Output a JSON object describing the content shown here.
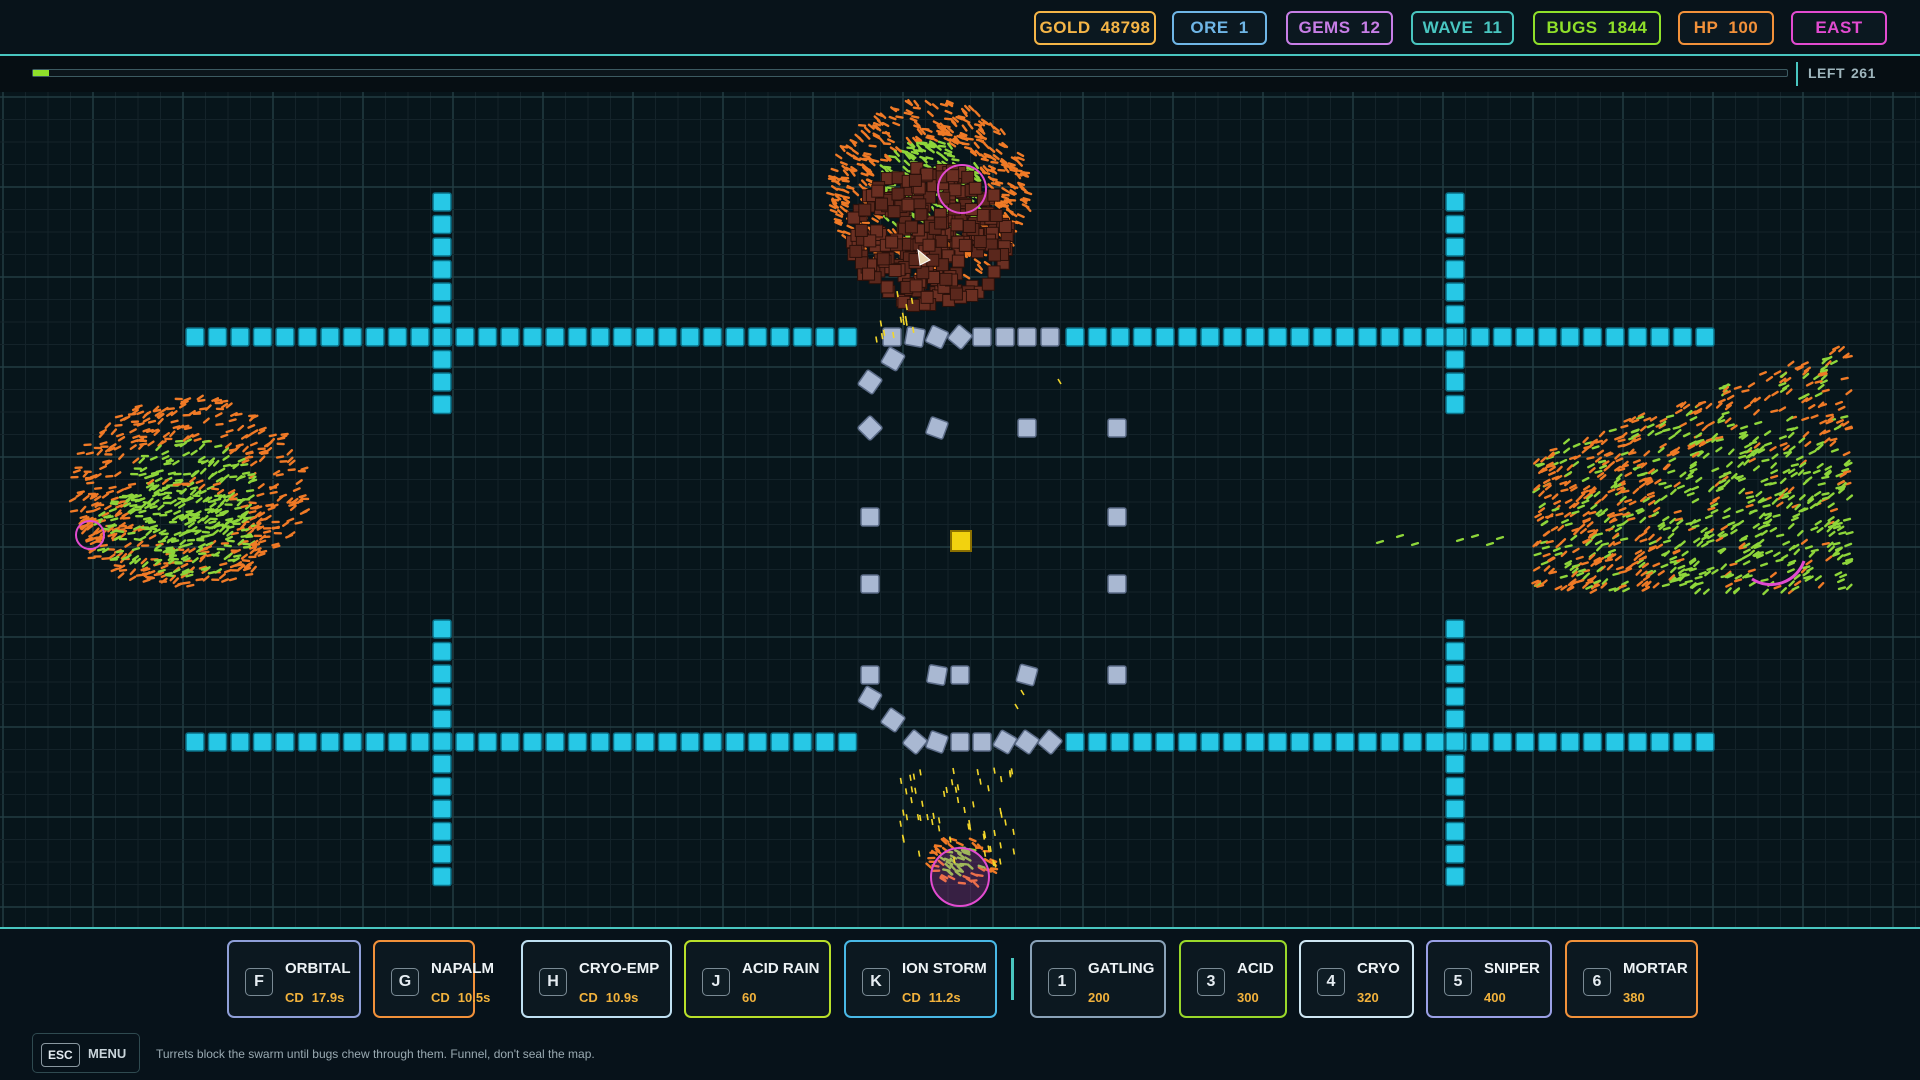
{
  "hud": {
    "stats": [
      {
        "label": "GOLD",
        "value": "48798",
        "color": "#f5b547"
      },
      {
        "label": "ORE",
        "value": "1",
        "color": "#6fb6e6"
      },
      {
        "label": "GEMS",
        "value": "12",
        "color": "#c77ee6"
      },
      {
        "label": "WAVE",
        "value": "11",
        "color": "#49c6c0"
      },
      {
        "label": "BUGS",
        "value": "1844",
        "color": "#8fe02a"
      },
      {
        "label": "HP",
        "value": "100",
        "color": "#f2913a"
      },
      {
        "label": "EAST",
        "value": "",
        "color": "#e24bd0"
      }
    ],
    "wave_progress": 0.009,
    "left_label": "LEFT",
    "left_value": "261"
  },
  "abilities": [
    {
      "key": "F",
      "name": "ORBITAL",
      "cd_label": "CD",
      "cd": "17.9s",
      "color": "#8f9fd8"
    },
    {
      "key": "G",
      "name": "NAPALM",
      "cd_label": "CD",
      "cd": "10.5s",
      "color": "#f2913a"
    },
    {
      "key": "H",
      "name": "CRYO-EMP",
      "cd_label": "CD",
      "cd": "10.9s",
      "color": "#bfe0f2"
    },
    {
      "key": "J",
      "name": "ACID RAIN",
      "cd_label": "",
      "cd": "60",
      "color": "#b9e02a"
    },
    {
      "key": "K",
      "name": "ION STORM",
      "cd_label": "CD",
      "cd": "11.2s",
      "color": "#49b8e6"
    }
  ],
  "turrets": [
    {
      "key": "1",
      "name": "GATLING",
      "cost": "200",
      "color": "#8aa2b8"
    },
    {
      "key": "3",
      "name": "ACID",
      "cost": "300",
      "color": "#9ad82a"
    },
    {
      "key": "4",
      "name": "CRYO",
      "cost": "320",
      "color": "#cfe6f2"
    },
    {
      "key": "5",
      "name": "SNIPER",
      "cost": "400",
      "color": "#9aa0e6"
    },
    {
      "key": "6",
      "name": "MORTAR",
      "cost": "380",
      "color": "#f2913a"
    }
  ],
  "menu": {
    "key": "ESC",
    "label": "MENU"
  },
  "hint": "Turrets block the swarm until bugs chew through them. Funnel, don't seal the map.",
  "colors": {
    "grid_minor": "#14232a",
    "grid_major": "#223d42",
    "wall": "#27c8e6",
    "turret": "#a9b8d2",
    "core": "#f2d20f",
    "bug_orange": "#f07a26",
    "bug_green": "#8ed63a",
    "bug_brown": "#6a2f22",
    "spawn_ring": "#e24bd0"
  }
}
